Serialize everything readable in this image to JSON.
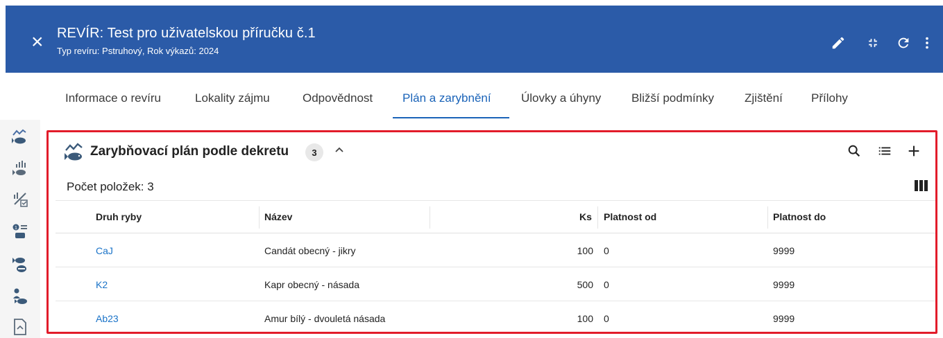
{
  "header": {
    "title": "REVÍR: Test pro uživatelskou příručku č.1",
    "subtitle": "Typ revíru: Pstruhový, Rok výkazů: 2024"
  },
  "tabs": [
    {
      "label": "Informace o revíru"
    },
    {
      "label": "Lokality zájmu"
    },
    {
      "label": "Odpovědnost"
    },
    {
      "label": "Plán a zarybnění",
      "active": true
    },
    {
      "label": "Úlovky a úhyny"
    },
    {
      "label": "Bližší podmínky"
    },
    {
      "label": "Zjištění"
    },
    {
      "label": "Přílohy"
    }
  ],
  "panel": {
    "title": "Zarybňovací plán podle dekretu",
    "count": "3",
    "items_count_label": "Počet položek: 3"
  },
  "table": {
    "columns": [
      "Druh ryby",
      "Název",
      "Ks",
      "Platnost od",
      "Platnost do"
    ],
    "rows": [
      {
        "druh": "CaJ",
        "nazev": "Candát obecný - jikry",
        "ks": "100",
        "od": "0",
        "do": "9999"
      },
      {
        "druh": "K2",
        "nazev": "Kapr obecný - násada",
        "ks": "500",
        "od": "0",
        "do": "9999"
      },
      {
        "druh": "Ab23",
        "nazev": "Amur bílý - dvouletá násada",
        "ks": "100",
        "od": "0",
        "do": "9999"
      }
    ]
  },
  "icons": {
    "header_actions": [
      "edit-icon",
      "collapse-icon",
      "refresh-icon",
      "more-vert-icon"
    ],
    "panel_tools": [
      "search-icon",
      "list-icon",
      "add-icon"
    ],
    "leftbar": [
      "fish-plan-icon",
      "fish-stats-icon",
      "percent-check-icon",
      "ranking-icon",
      "fish-bowl-icon",
      "fisherman-icon",
      "document-icon"
    ]
  },
  "colors": {
    "header_bg": "#2b5ba8",
    "accent": "#1a63b8",
    "highlight_border": "#e21c2a",
    "link": "#1a73c8"
  }
}
